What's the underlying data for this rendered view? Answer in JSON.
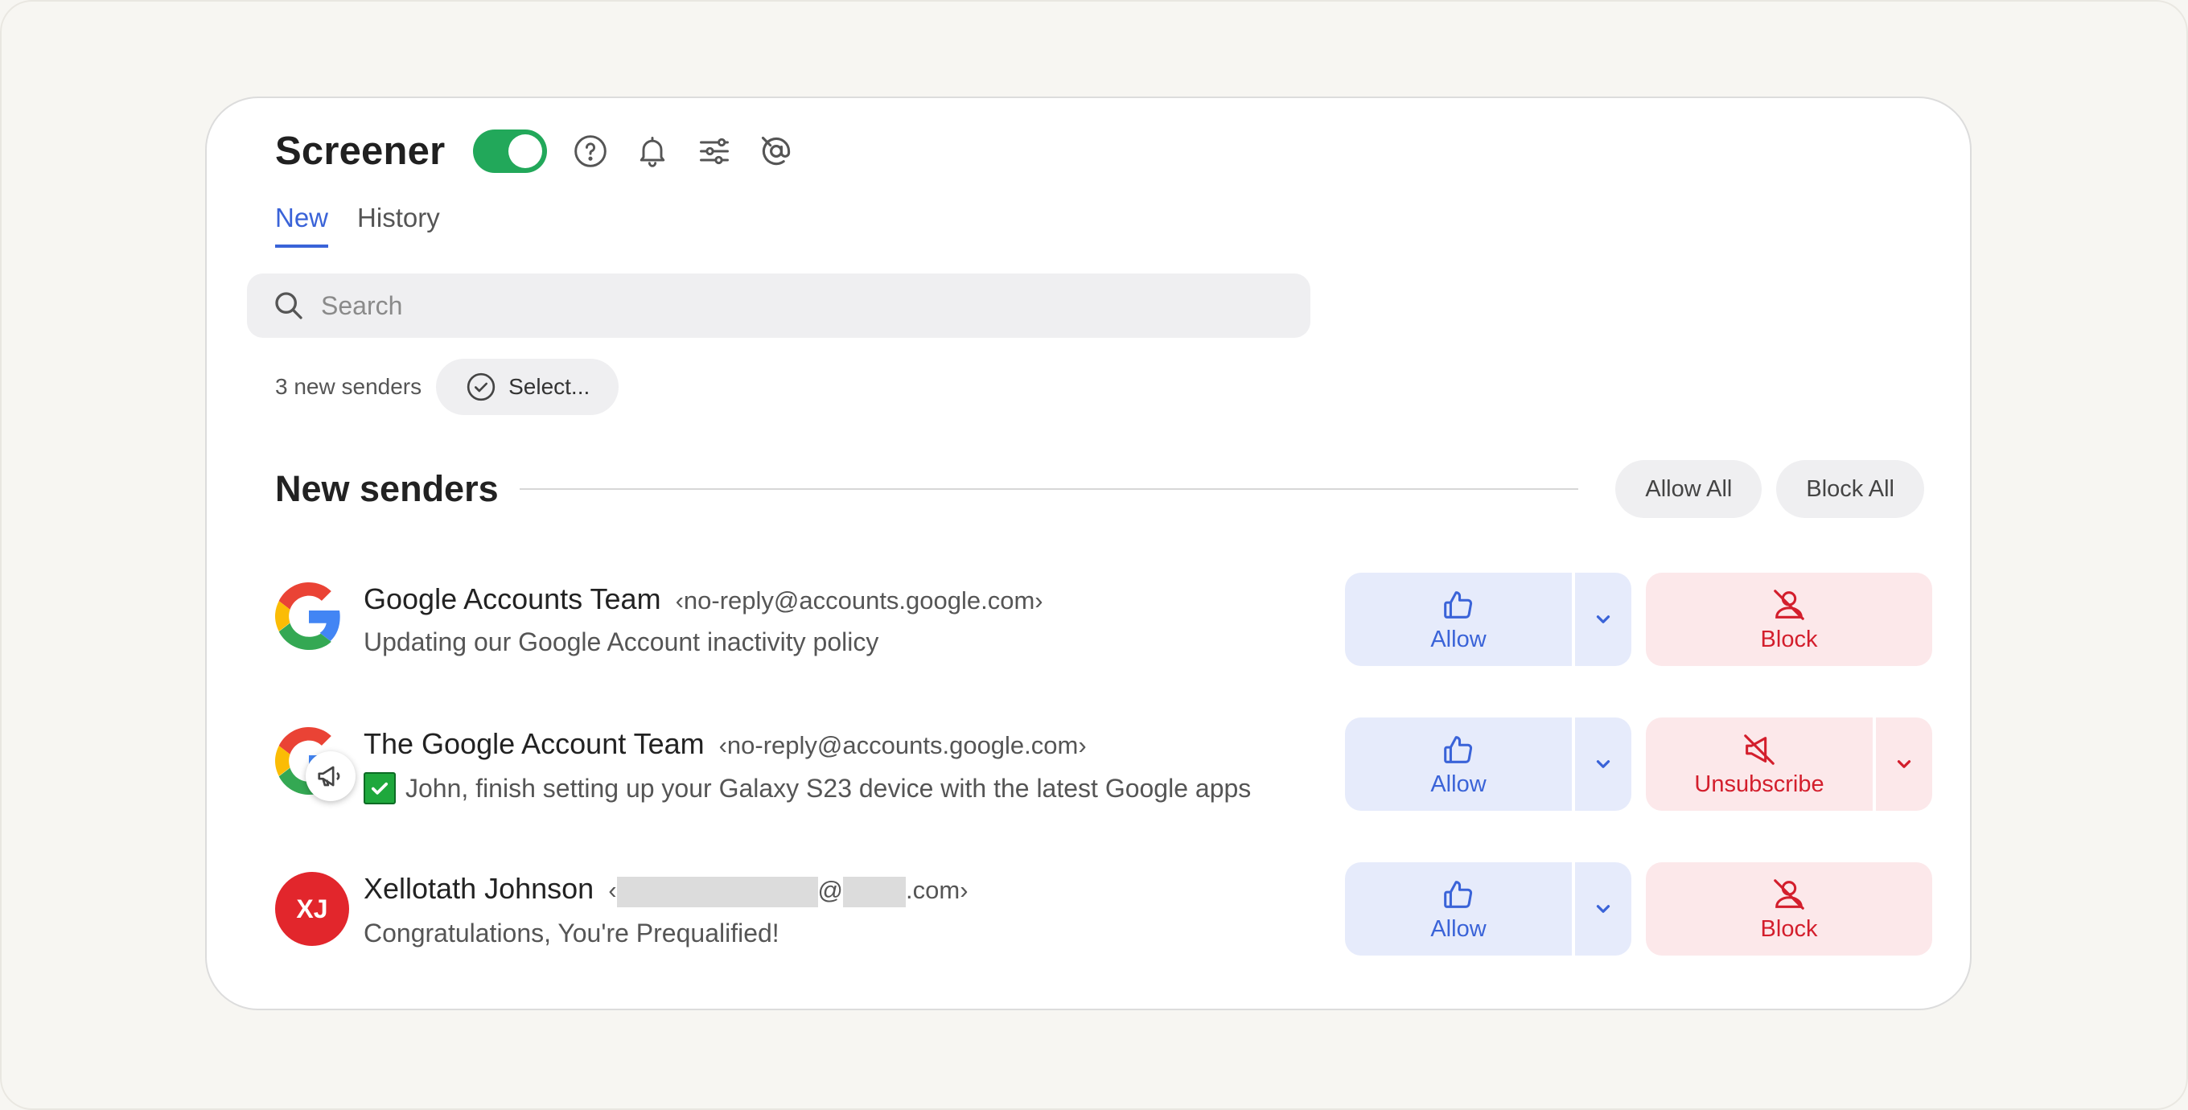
{
  "app": {
    "title": "Screener",
    "toggle_on": true,
    "header_icons": [
      "help-icon",
      "bell-icon",
      "filters-icon",
      "at-sign-off-icon"
    ]
  },
  "tabs": [
    {
      "label": "New",
      "active": true
    },
    {
      "label": "History",
      "active": false
    }
  ],
  "search": {
    "placeholder": "Search",
    "value": ""
  },
  "meta": {
    "count_text": "3 new senders",
    "select_label": "Select..."
  },
  "section": {
    "title": "New senders",
    "allow_all": "Allow All",
    "block_all": "Block All"
  },
  "senders": [
    {
      "name": "Google Accounts Team",
      "email": "‹no-reply@accounts.google.com›",
      "subject": "Updating our Google Account inactivity policy",
      "avatar": "google-logo",
      "allow_label": "Allow",
      "action_label": "Block"
    },
    {
      "name": "The Google Account Team",
      "email": "‹no-reply@accounts.google.com›",
      "subject": "John, finish setting up your Galaxy S23 device with the latest Google apps",
      "avatar": "google-logo",
      "badge": "megaphone-icon",
      "allow_label": "Allow",
      "action_label": "Unsubscribe"
    },
    {
      "name": "Xellotath Johnson",
      "email_open": "‹",
      "email_at": "@",
      "email_close": ".com›",
      "subject": "Congratulations, You're Prequalified!",
      "avatar_initials": "XJ",
      "avatar_color": "#e2262c",
      "allow_label": "Allow",
      "action_label": "Block"
    }
  ],
  "colors": {
    "accent": "#3a63d8",
    "toggle": "#22a85a",
    "danger": "#d31e2c"
  }
}
